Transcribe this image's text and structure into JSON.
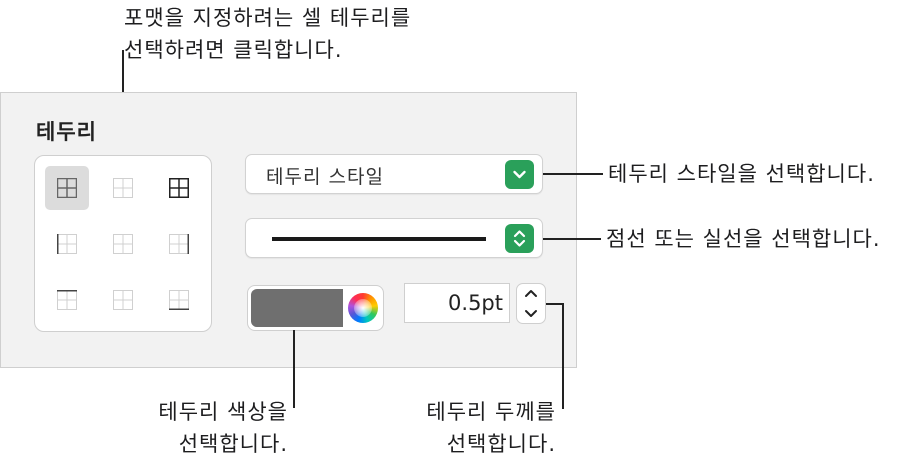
{
  "panel": {
    "title": "테두리",
    "border_style_dropdown": {
      "label": "테두리 스타일"
    },
    "thickness": {
      "value": "0.5pt"
    },
    "color_well": {
      "color": "#6f6f6f"
    }
  },
  "callouts": {
    "top_line1": "포맷을 지정하려는 셀 테두리를",
    "top_line2": "선택하려면 클릭합니다.",
    "style": "테두리 스타일을 선택합니다.",
    "line": "점선 또는 실선을 선택합니다.",
    "color_line1": "테두리 색상을",
    "color_line2": "선택합니다.",
    "thickness_line1": "테두리 두께를",
    "thickness_line2": "선택합니다."
  },
  "colors": {
    "accent": "#2aa05a",
    "panel_bg": "#f2f2f2"
  },
  "icons": {
    "border_buttons": [
      "border-all-inner-icon",
      "border-inner-icon",
      "border-all-icon",
      "border-left-icon",
      "border-inner-vertical-icon",
      "border-right-icon",
      "border-top-icon",
      "border-inner-horizontal-icon",
      "border-bottom-icon"
    ]
  }
}
